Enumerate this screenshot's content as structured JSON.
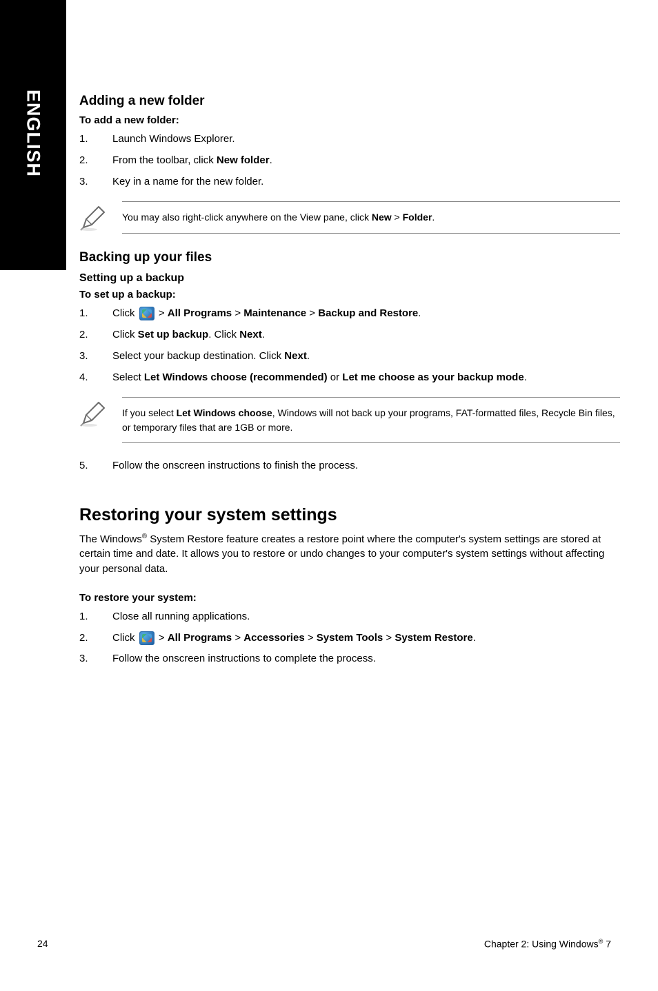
{
  "sidebar": {
    "label": "ENGLISH"
  },
  "sections": {
    "adding": {
      "title": "Adding a new folder",
      "intro": "To add a new folder:",
      "steps": {
        "s1": {
          "num": "1.",
          "text": "Launch Windows Explorer."
        },
        "s2": {
          "num": "2.",
          "prefix": "From the toolbar, click ",
          "bold": "New folder",
          "suffix": "."
        },
        "s3": {
          "num": "3.",
          "text": "Key in a name for the new folder."
        }
      },
      "note": {
        "prefix": "You may also right-click anywhere on the View pane, click ",
        "b1": "New",
        "mid": " > ",
        "b2": "Folder",
        "suffix": "."
      }
    },
    "backing": {
      "title": "Backing up your files",
      "subtitle": "Setting up a backup",
      "intro": "To set up a backup:",
      "steps": {
        "s1": {
          "num": "1.",
          "prefix": "Click ",
          "after_icon": " > ",
          "b1": "All Programs",
          "sep1": " > ",
          "b2": "Maintenance",
          "sep2": " > ",
          "b3": "Backup and Restore",
          "suffix": "."
        },
        "s2": {
          "num": "2.",
          "prefix": "Click ",
          "b1": "Set up backup",
          "mid": ". Click ",
          "b2": "Next",
          "suffix": "."
        },
        "s3": {
          "num": "3.",
          "prefix": "Select your backup destination. Click ",
          "b1": "Next",
          "suffix": "."
        },
        "s4": {
          "num": "4.",
          "prefix": "Select ",
          "b1": "Let Windows choose (recommended)",
          "mid": " or ",
          "b2": "Let me choose as your backup mode",
          "suffix": "."
        }
      },
      "note": {
        "prefix": "If you select ",
        "b1": "Let Windows choose",
        "suffix": ", Windows will not back up your programs, FAT-formatted files, Recycle Bin files, or temporary files that are 1GB or more."
      },
      "step5": {
        "num": "5.",
        "text": "Follow the onscreen instructions to finish the process."
      }
    },
    "restoring": {
      "title": "Restoring your system settings",
      "para_pre": "The Windows",
      "para_sup": "®",
      "para_post": " System Restore feature creates a restore point where the computer's system settings are stored at certain time and date. It allows you to restore or undo changes to your computer's system settings without affecting your personal data.",
      "intro": "To restore your system:",
      "steps": {
        "s1": {
          "num": "1.",
          "text": "Close all running applications."
        },
        "s2": {
          "num": "2.",
          "prefix": "Click ",
          "after_icon": " > ",
          "b1": "All Programs",
          "sep1": " > ",
          "b2": "Accessories",
          "sep2": " > ",
          "b3": "System Tools",
          "sep3": " > ",
          "b4": "System Restore",
          "suffix": "."
        },
        "s3": {
          "num": "3.",
          "text": "Follow the onscreen instructions to complete the process."
        }
      }
    }
  },
  "footer": {
    "page": "24",
    "chapter_pre": "Chapter 2: Using Windows",
    "chapter_sup": "®",
    "chapter_post": " 7"
  }
}
